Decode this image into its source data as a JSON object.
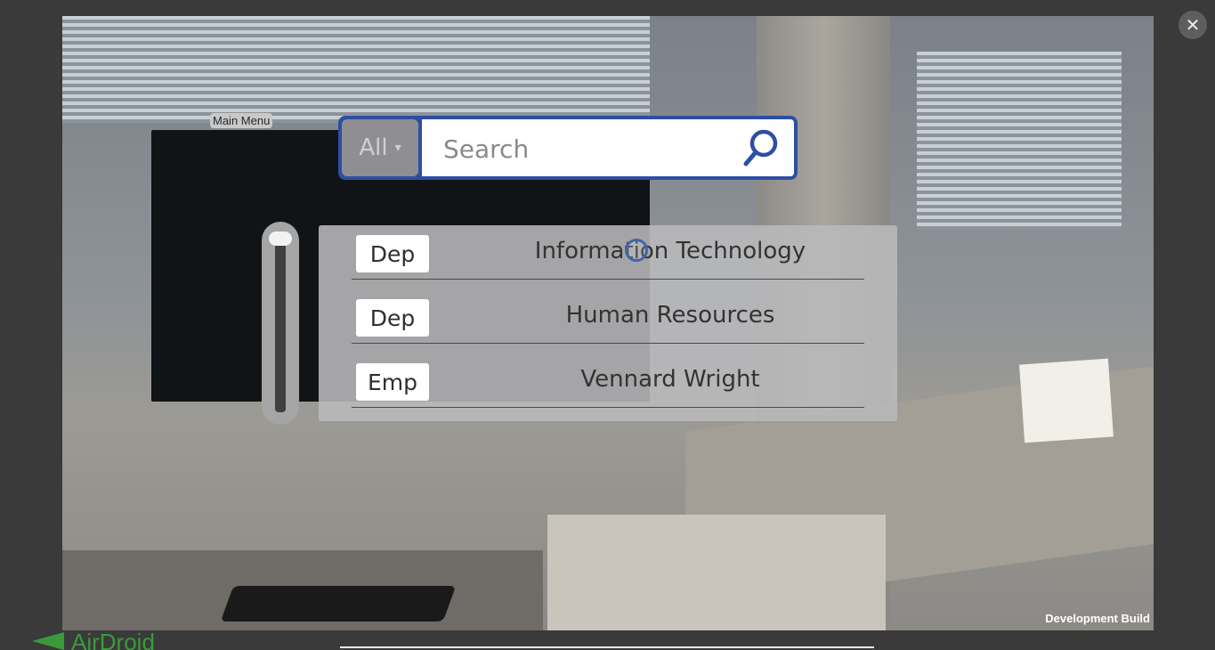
{
  "window": {
    "close_symbol": "✕"
  },
  "main_menu": {
    "label": "Main Menu"
  },
  "search": {
    "filter_label": "All",
    "filter_caret": "▾",
    "placeholder": "Search",
    "value": ""
  },
  "scrollbar": {
    "position": 0
  },
  "results": [
    {
      "tag": "Dep",
      "name": "Information Technology"
    },
    {
      "tag": "Dep",
      "name": "Human Resources"
    },
    {
      "tag": "Emp",
      "name": "Vennard Wright"
    }
  ],
  "footer": {
    "build_label": "Development Build",
    "brand": "AirDroid"
  },
  "colors": {
    "search_border": "#2d4fa3",
    "brand_green": "#3a9a3a"
  }
}
